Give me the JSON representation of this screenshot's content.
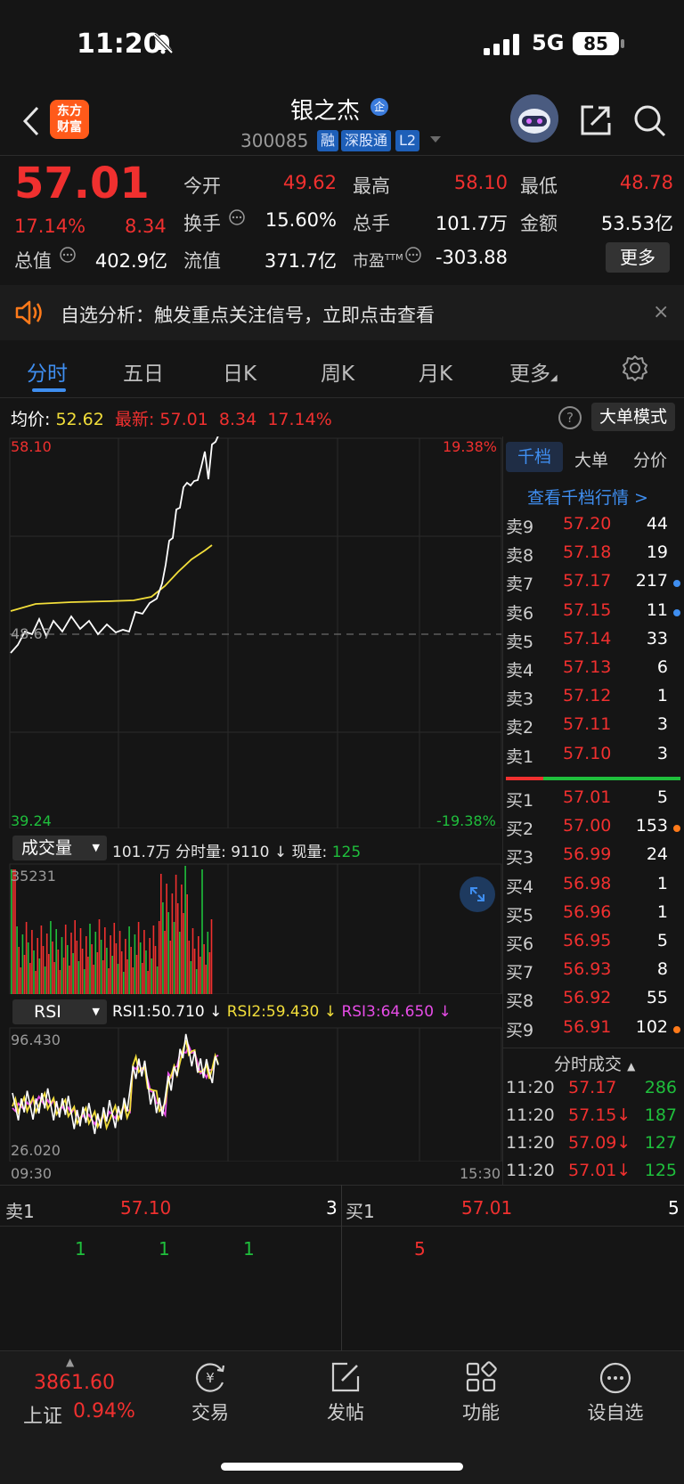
{
  "status": {
    "time": "11:20",
    "network": "5G",
    "battery": "85"
  },
  "header": {
    "logo": "东方\n财富",
    "stock_name": "银之杰",
    "badge": "企",
    "code": "300085",
    "tags": [
      "融",
      "深股通",
      "L2"
    ]
  },
  "quote": {
    "price": "57.01",
    "pct": "17.14%",
    "change": "8.34",
    "fields": [
      {
        "label": "今开",
        "value": "49.62",
        "color": "red"
      },
      {
        "label": "最高",
        "value": "58.10",
        "color": "red"
      },
      {
        "label": "最低",
        "value": "48.78",
        "color": "red"
      },
      {
        "label": "换手",
        "value": "15.60%",
        "color": "white"
      },
      {
        "label": "总手",
        "value": "101.7万",
        "color": "white"
      },
      {
        "label": "金额",
        "value": "53.53亿",
        "color": "white"
      },
      {
        "label": "总值",
        "value": "402.9亿",
        "color": "white"
      },
      {
        "label": "流值",
        "value": "371.7亿",
        "color": "white"
      },
      {
        "label": "市盈",
        "label_sup": "TTM",
        "value": "-303.88",
        "color": "white"
      }
    ],
    "more_label": "更多"
  },
  "notice": {
    "text": "自选分析：触发重点关注信号，立即点击查看",
    "close": "×"
  },
  "tabs": [
    "分时",
    "五日",
    "日K",
    "周K",
    "月K",
    "更多"
  ],
  "avg_line": {
    "avg_label": "均价:",
    "avg_value": "52.62",
    "latest_label": "最新:",
    "latest_value": "57.01",
    "latest_change": "8.34",
    "latest_pct": "17.14%",
    "help": "?",
    "mode_button": "大单模式"
  },
  "chart_data": {
    "type": "line",
    "price_axis": {
      "max": "58.10",
      "base": "48.67",
      "min": "39.24",
      "max_pct": "19.38%",
      "min_pct": "-19.38%"
    },
    "time_axis": {
      "start": "09:30",
      "end": "15:30"
    },
    "volume": {
      "selector": "成交量",
      "total": "101.7万",
      "fenshi_label": "分时量:",
      "fenshi_value": "9110",
      "now_label": "现量:",
      "now_value": "125",
      "max_label": "35231"
    },
    "rsi": {
      "selector": "RSI",
      "rsi1": "RSI1:50.710",
      "rsi2": "RSI2:59.430",
      "rsi3": "RSI3:64.650",
      "max_label": "96.430",
      "min_label": "26.020"
    },
    "colors": {
      "price": "#ffffff",
      "avg": "#f2de3a",
      "rsi1": "#ffffff",
      "rsi2": "#f2de3a",
      "rsi3": "#e64ce6",
      "up": "#f0302f",
      "down": "#1fbf3c"
    }
  },
  "orderbook": {
    "tabs": [
      "千档",
      "大单",
      "分价"
    ],
    "link": "查看千档行情 >",
    "sell": [
      {
        "label": "卖9",
        "price": "57.20",
        "qty": "44",
        "dot": ""
      },
      {
        "label": "卖8",
        "price": "57.18",
        "qty": "19",
        "dot": ""
      },
      {
        "label": "卖7",
        "price": "57.17",
        "qty": "217",
        "dot": "#3f8ef0"
      },
      {
        "label": "卖6",
        "price": "57.15",
        "qty": "11",
        "dot": "#3f8ef0"
      },
      {
        "label": "卖5",
        "price": "57.14",
        "qty": "33",
        "dot": ""
      },
      {
        "label": "卖4",
        "price": "57.13",
        "qty": "6",
        "dot": ""
      },
      {
        "label": "卖3",
        "price": "57.12",
        "qty": "1",
        "dot": ""
      },
      {
        "label": "卖2",
        "price": "57.11",
        "qty": "3",
        "dot": ""
      },
      {
        "label": "卖1",
        "price": "57.10",
        "qty": "3",
        "dot": ""
      }
    ],
    "buy": [
      {
        "label": "买1",
        "price": "57.01",
        "qty": "5",
        "dot": ""
      },
      {
        "label": "买2",
        "price": "57.00",
        "qty": "153",
        "dot": "#ff7a1a"
      },
      {
        "label": "买3",
        "price": "56.99",
        "qty": "24",
        "dot": ""
      },
      {
        "label": "买4",
        "price": "56.98",
        "qty": "1",
        "dot": ""
      },
      {
        "label": "买5",
        "price": "56.96",
        "qty": "1",
        "dot": ""
      },
      {
        "label": "买6",
        "price": "56.95",
        "qty": "5",
        "dot": ""
      },
      {
        "label": "买7",
        "price": "56.93",
        "qty": "8",
        "dot": ""
      },
      {
        "label": "买8",
        "price": "56.92",
        "qty": "55",
        "dot": ""
      },
      {
        "label": "买9",
        "price": "56.91",
        "qty": "102",
        "dot": "#ff7a1a"
      }
    ],
    "ticks_title": "分时成交",
    "ticks": [
      {
        "time": "11:20",
        "price": "57.17",
        "vol": "286"
      },
      {
        "time": "11:20",
        "price": "57.15↓",
        "vol": "187"
      },
      {
        "time": "11:20",
        "price": "57.09↓",
        "vol": "127"
      },
      {
        "time": "11:20",
        "price": "57.01↓",
        "vol": "125"
      }
    ]
  },
  "level1": {
    "sell_label": "卖1",
    "sell_price": "57.10",
    "sell_qty": "3",
    "buy_label": "买1",
    "buy_price": "57.01",
    "buy_qty": "5",
    "sell_queue": [
      "1",
      "1",
      "1"
    ],
    "buy_queue": [
      "5"
    ]
  },
  "tabbar": {
    "index_value": "3861.60",
    "index_name": "上证",
    "index_pct": "0.94%",
    "items": [
      "交易",
      "发帖",
      "功能",
      "设自选"
    ]
  }
}
